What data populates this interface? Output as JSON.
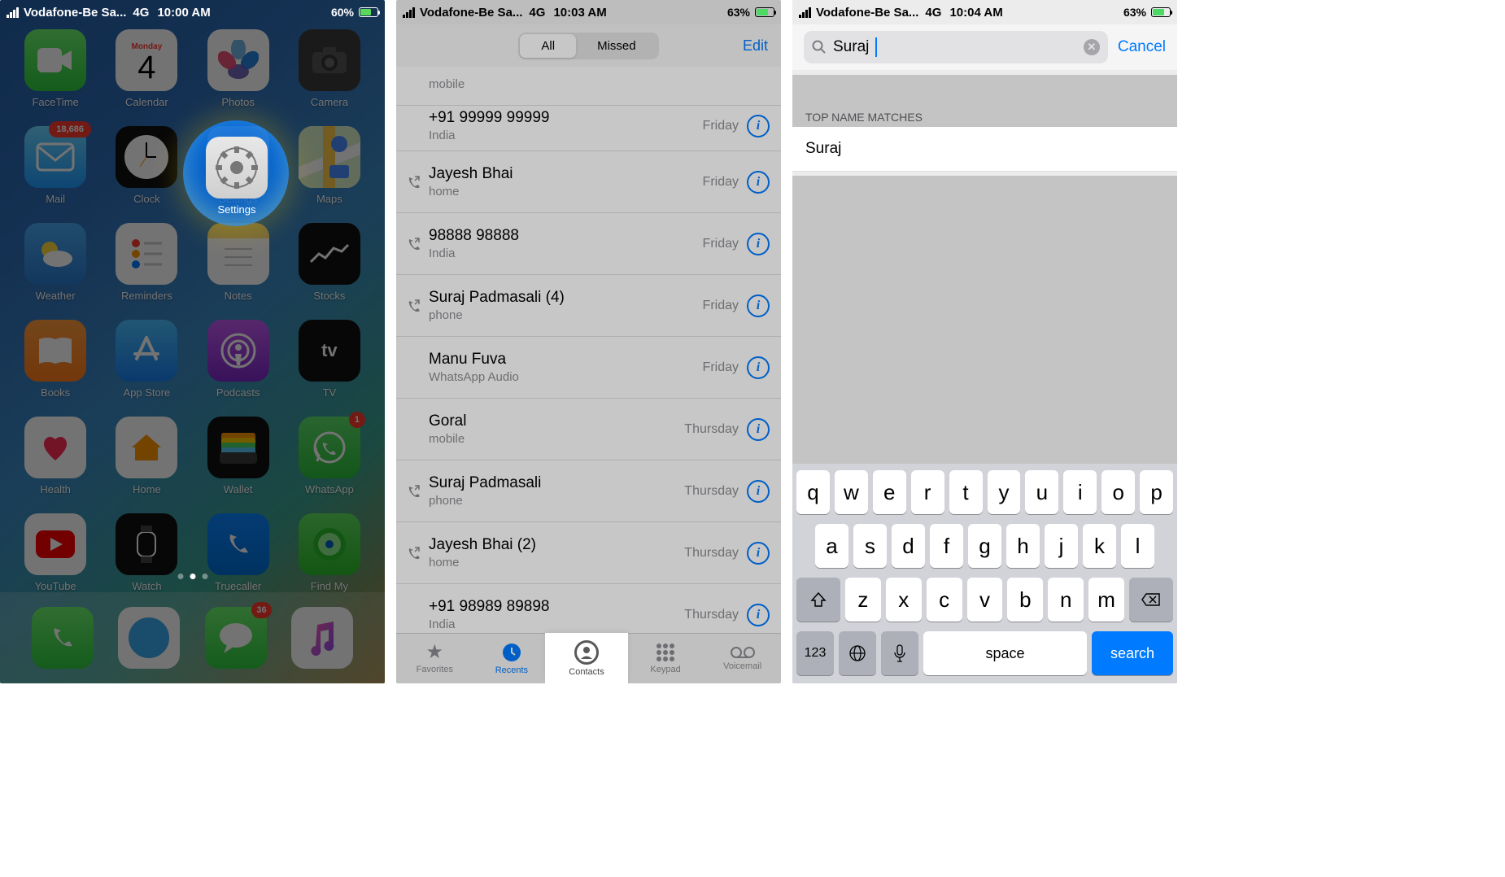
{
  "screen1": {
    "status": {
      "carrier": "Vodafone-Be Sa...",
      "network": "4G",
      "time": "10:00 AM",
      "battery_pct": "60%",
      "battery_fill": 60
    },
    "calendar": {
      "dow": "Monday",
      "day": "4"
    },
    "badges": {
      "mail": "18,686",
      "whatsapp": "1",
      "messages": "36"
    },
    "apps": {
      "facetime": "FaceTime",
      "calendar": "Calendar",
      "photos": "Photos",
      "camera": "Camera",
      "mail": "Mail",
      "clock": "Clock",
      "settings": "Settings",
      "maps": "Maps",
      "weather": "Weather",
      "reminders": "Reminders",
      "notes": "Notes",
      "stocks": "Stocks",
      "books": "Books",
      "appstore": "App Store",
      "podcasts": "Podcasts",
      "tv": "TV",
      "health": "Health",
      "home": "Home",
      "wallet": "Wallet",
      "whatsapp": "WhatsApp",
      "youtube": "YouTube",
      "watch": "Watch",
      "truecaller": "Truecaller",
      "findmy": "Find My"
    },
    "highlight_label": "Settings"
  },
  "screen2": {
    "status": {
      "carrier": "Vodafone-Be Sa...",
      "network": "4G",
      "time": "10:03 AM",
      "battery_pct": "63%",
      "battery_fill": 63
    },
    "segments": {
      "all": "All",
      "missed": "Missed"
    },
    "edit": "Edit",
    "partial_sub": "mobile",
    "calls": [
      {
        "name": "+91 99999 99999",
        "sub": "India",
        "time": "Friday",
        "out": false
      },
      {
        "name": "Jayesh Bhai",
        "sub": "home",
        "time": "Friday",
        "out": true
      },
      {
        "name": "98888 98888",
        "sub": "India",
        "time": "Friday",
        "out": true
      },
      {
        "name": "Suraj Padmasali (4)",
        "sub": "phone",
        "time": "Friday",
        "out": true
      },
      {
        "name": "Manu Fuva",
        "sub": "WhatsApp Audio",
        "time": "Friday",
        "out": false
      },
      {
        "name": "Goral",
        "sub": "mobile",
        "time": "Thursday",
        "out": false
      },
      {
        "name": "Suraj Padmasali",
        "sub": "phone",
        "time": "Thursday",
        "out": true
      },
      {
        "name": "Jayesh Bhai (2)",
        "sub": "home",
        "time": "Thursday",
        "out": true
      },
      {
        "name": "+91 98989 89898",
        "sub": "India",
        "time": "Thursday",
        "out": false
      }
    ],
    "tabs": {
      "favorites": "Favorites",
      "recents": "Recents",
      "contacts": "Contacts",
      "keypad": "Keypad",
      "voicemail": "Voicemail"
    }
  },
  "screen3": {
    "status": {
      "carrier": "Vodafone-Be Sa...",
      "network": "4G",
      "time": "10:04 AM",
      "battery_pct": "63%",
      "battery_fill": 63
    },
    "search_value": "Suraj",
    "cancel": "Cancel",
    "section": "TOP NAME MATCHES",
    "result": "Suraj",
    "keyboard": {
      "row1": [
        "q",
        "w",
        "e",
        "r",
        "t",
        "y",
        "u",
        "i",
        "o",
        "p"
      ],
      "row2": [
        "a",
        "s",
        "d",
        "f",
        "g",
        "h",
        "j",
        "k",
        "l"
      ],
      "row3": [
        "z",
        "x",
        "c",
        "v",
        "b",
        "n",
        "m"
      ],
      "k123": "123",
      "space": "space",
      "search": "search"
    }
  }
}
